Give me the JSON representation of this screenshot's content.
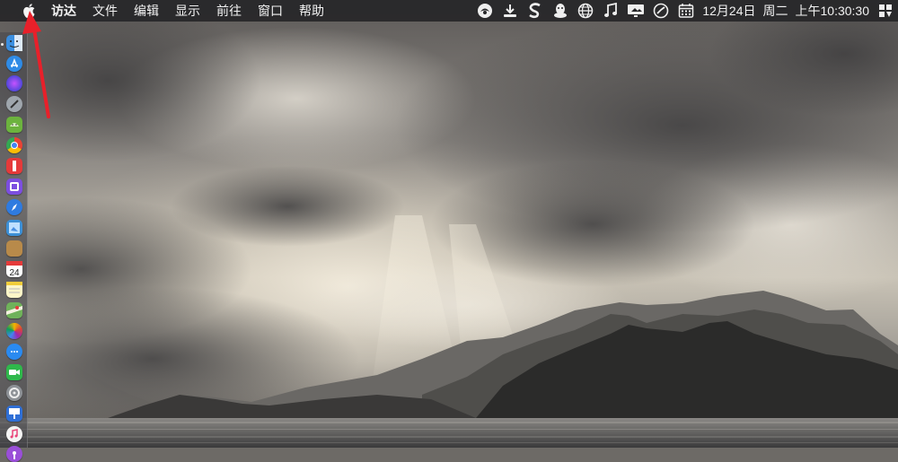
{
  "menubar": {
    "app_name": "访达",
    "menus": [
      "文件",
      "编辑",
      "显示",
      "前往",
      "窗口",
      "帮助"
    ],
    "status": {
      "date": "12月24日",
      "weekday": "周二",
      "time": "上午10:30:30"
    }
  },
  "dock": {
    "calendar_day": "24"
  },
  "colors": {
    "menubar_bg": "#262628",
    "annotation_arrow": "#e8202a"
  }
}
